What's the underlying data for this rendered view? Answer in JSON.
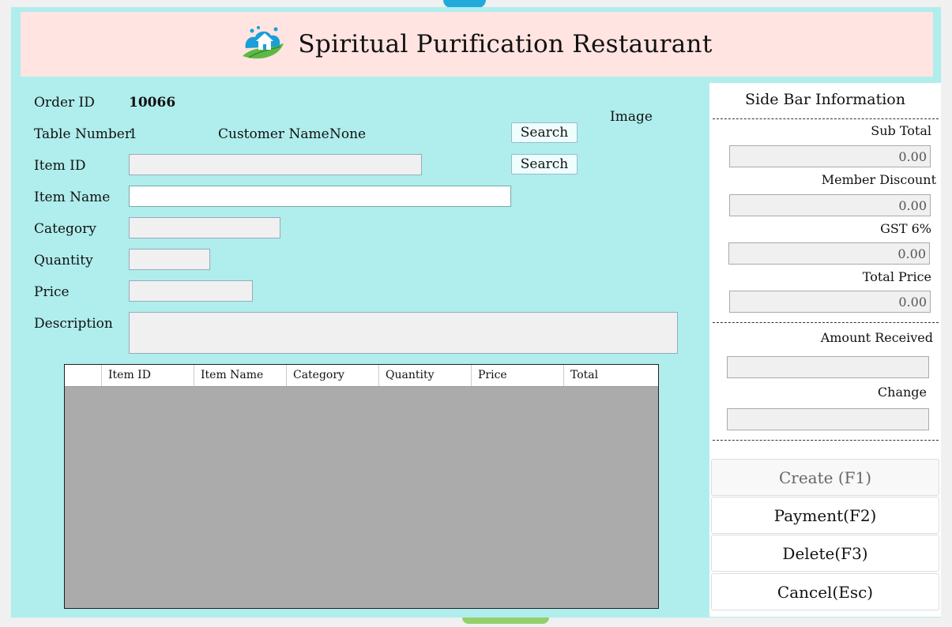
{
  "header": {
    "title": "Spiritual Purification Restaurant",
    "logo_icon": "house-leaf-logo"
  },
  "form": {
    "order_id_label": "Order ID",
    "order_id_value": "10066",
    "table_number_label": "Table Number",
    "table_number_value": "1",
    "customer_name_label": "Customer Name",
    "customer_name_value": "None",
    "search_label": "Search",
    "image_label": "Image",
    "item_id_label": "Item ID",
    "item_id_value": "",
    "item_name_label": "Item Name",
    "item_name_value": "",
    "category_label": "Category",
    "category_value": "",
    "quantity_label": "Quantity",
    "quantity_value": "",
    "price_label": "Price",
    "price_value": "",
    "description_label": "Description",
    "description_value": ""
  },
  "table": {
    "columns": [
      "",
      "Item ID",
      "Item Name",
      "Category",
      "Quantity",
      "Price",
      "Total"
    ],
    "rows": []
  },
  "sidebar": {
    "title": "Side Bar Information",
    "sub_total_label": "Sub Total",
    "sub_total_value": "0.00",
    "member_discount_label": "Member Discount",
    "member_discount_value": "0.00",
    "gst_label": "GST 6%",
    "gst_value": "0.00",
    "total_price_label": "Total Price",
    "total_price_value": "0.00",
    "amount_received_label": "Amount Received",
    "amount_received_value": "",
    "change_label": "Change",
    "change_value": ""
  },
  "actions": {
    "create_label": "Create (F1)",
    "payment_label": "Payment(F2)",
    "delete_label": "Delete(F3)",
    "cancel_label": "Cancel(Esc)"
  },
  "colors": {
    "frame_bg": "#b0eded",
    "header_bg": "#ffe4e1",
    "grid_bg": "#ababab",
    "sidebar_bg": "#ffffff"
  }
}
